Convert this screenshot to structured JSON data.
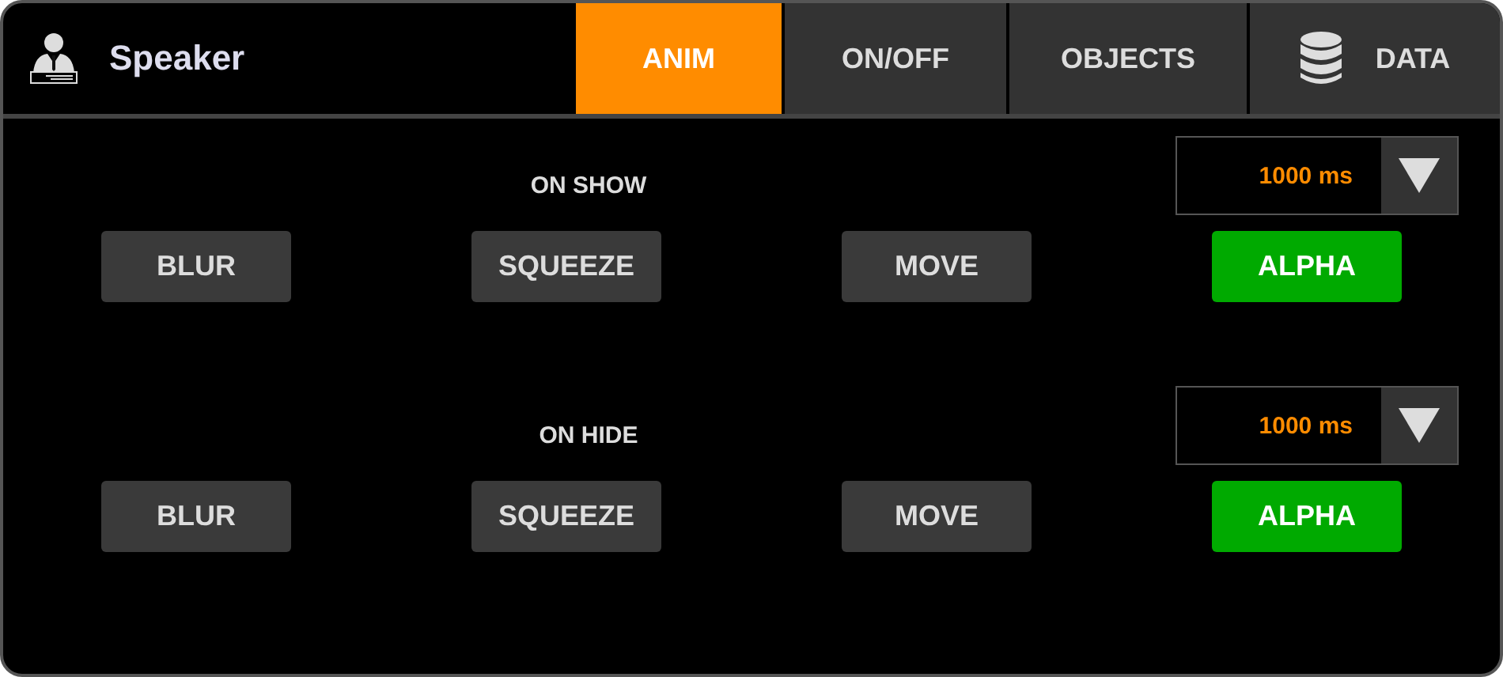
{
  "title": "Speaker",
  "tabs": [
    {
      "label": "ANIM",
      "selected": true,
      "kind": "text"
    },
    {
      "label": "ON/OFF",
      "selected": false,
      "kind": "text"
    },
    {
      "label": "OBJECTS",
      "selected": false,
      "kind": "text"
    },
    {
      "label": "DATA",
      "selected": false,
      "kind": "with-icon"
    }
  ],
  "sections": [
    {
      "label": "ON SHOW",
      "duration": "1000 ms",
      "options": [
        {
          "label": "BLUR",
          "selected": false
        },
        {
          "label": "SQUEEZE",
          "selected": false
        },
        {
          "label": "MOVE",
          "selected": false
        },
        {
          "label": "ALPHA",
          "selected": true
        }
      ]
    },
    {
      "label": "ON HIDE",
      "duration": "1000 ms",
      "options": [
        {
          "label": "BLUR",
          "selected": false
        },
        {
          "label": "SQUEEZE",
          "selected": false
        },
        {
          "label": "MOVE",
          "selected": false
        },
        {
          "label": "ALPHA",
          "selected": true
        }
      ]
    }
  ]
}
